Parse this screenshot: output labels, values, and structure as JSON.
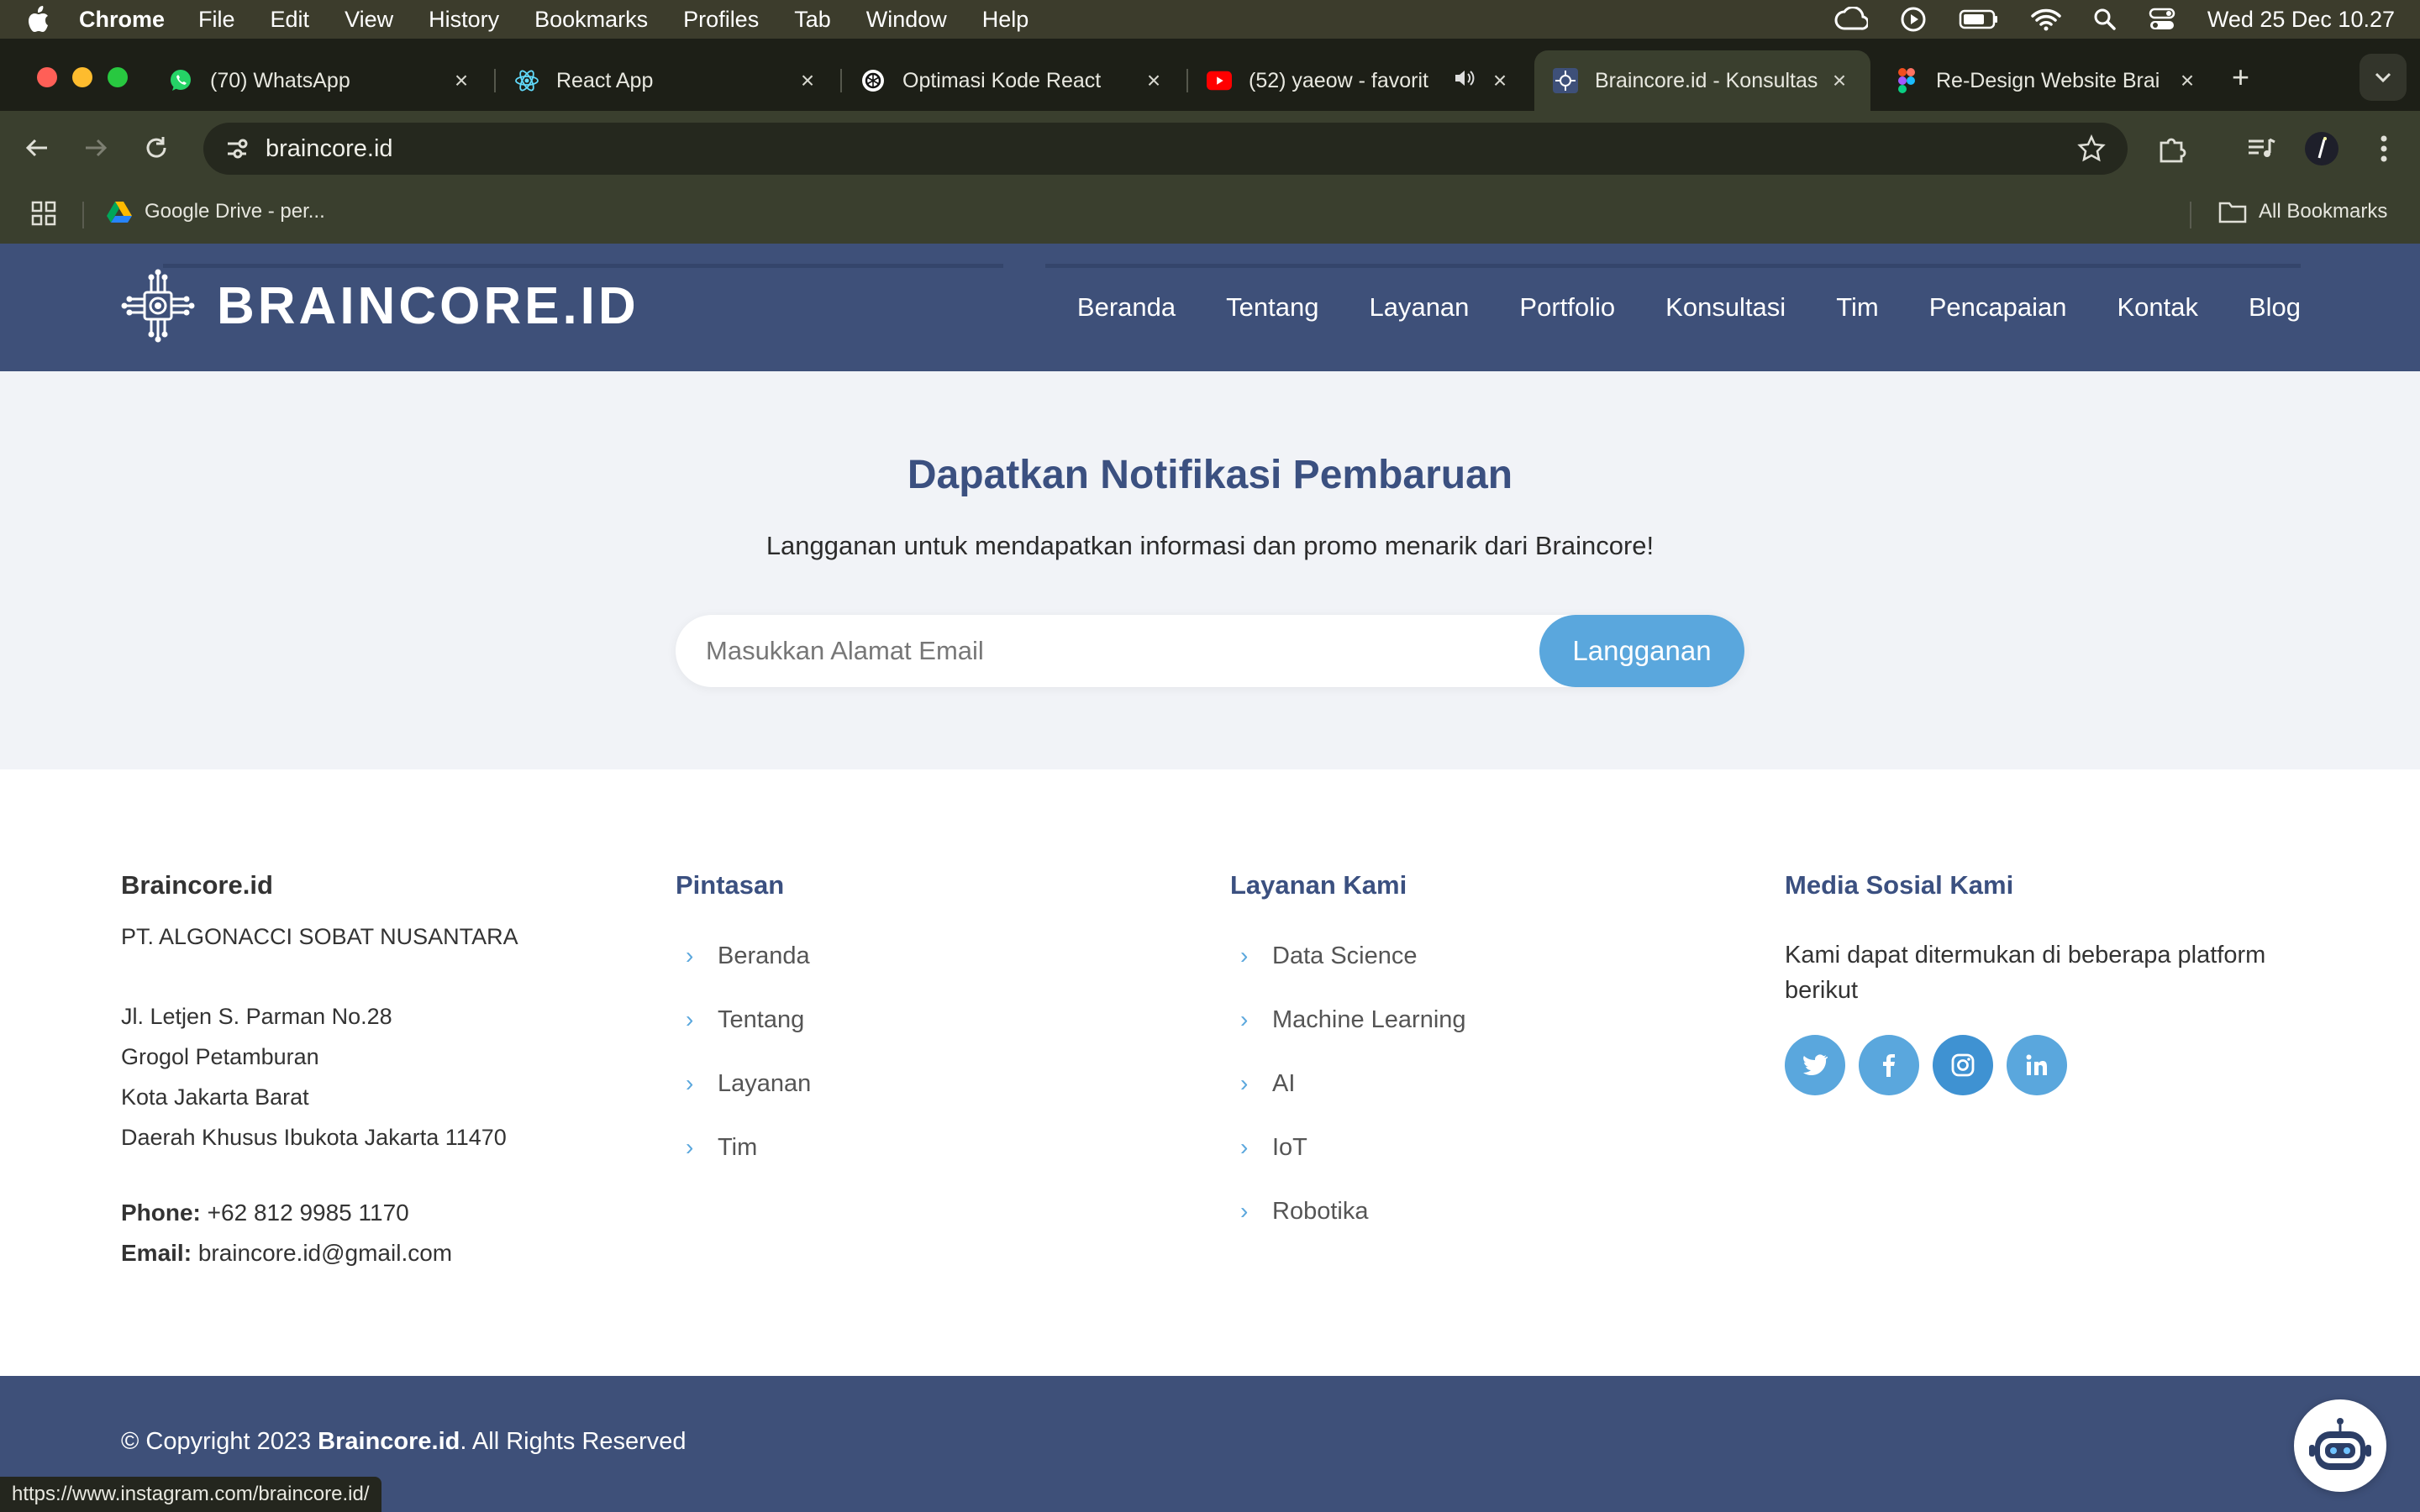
{
  "menubar": {
    "app": "Chrome",
    "items": [
      "File",
      "Edit",
      "View",
      "History",
      "Bookmarks",
      "Profiles",
      "Tab",
      "Window",
      "Help"
    ],
    "clock": "Wed 25 Dec  10.27"
  },
  "tabs": [
    {
      "title": "(70) WhatsApp"
    },
    {
      "title": "React App"
    },
    {
      "title": "Optimasi Kode React"
    },
    {
      "title": "(52) yaeow - favorit"
    },
    {
      "title": "Braincore.id - Konsultas"
    },
    {
      "title": "Re-Design Website Brai"
    }
  ],
  "address": {
    "url": "braincore.id"
  },
  "bookmarks": {
    "item": "Google Drive - per...",
    "all": "All Bookmarks"
  },
  "site": {
    "brand": "BRAINCORE.ID",
    "nav": [
      "Beranda",
      "Tentang",
      "Layanan",
      "Portfolio",
      "Konsultasi",
      "Tim",
      "Pencapaian",
      "Kontak",
      "Blog"
    ]
  },
  "newsletter": {
    "title": "Dapatkan Notifikasi Pembaruan",
    "subtitle": "Langganan untuk mendapatkan informasi dan promo menarik dari Braincore!",
    "placeholder": "Masukkan Alamat Email",
    "button": "Langganan"
  },
  "footer": {
    "col1": {
      "title": "Braincore.id",
      "company": "PT. ALGONACCI SOBAT NUSANTARA",
      "address": [
        "Jl. Letjen S. Parman No.28",
        "Grogol Petamburan",
        "Kota Jakarta Barat",
        "Daerah Khusus Ibukota Jakarta 11470"
      ],
      "phone_label": "Phone:",
      "phone": "+62 812 9985 1170",
      "email_label": "Email:",
      "email": "braincore.id@gmail.com"
    },
    "col2": {
      "title": "Pintasan",
      "links": [
        "Beranda",
        "Tentang",
        "Layanan",
        "Tim"
      ]
    },
    "col3": {
      "title": "Layanan Kami",
      "links": [
        "Data Science",
        "Machine Learning",
        "AI",
        "IoT",
        "Robotika"
      ]
    },
    "col4": {
      "title": "Media Sosial Kami",
      "desc": "Kami dapat ditermukan di beberapa platform berikut",
      "icons": [
        "twitter-icon",
        "facebook-icon",
        "instagram-icon",
        "linkedin-icon"
      ]
    }
  },
  "copyright": {
    "prefix": "© Copyright 2023 ",
    "brand": "Braincore.id",
    "suffix": ". All Rights Reserved"
  },
  "status": {
    "url": "https://www.instagram.com/braincore.id/"
  },
  "colors": {
    "header": "#3e5079",
    "accent": "#5aa7dd",
    "title": "#3b5080"
  }
}
